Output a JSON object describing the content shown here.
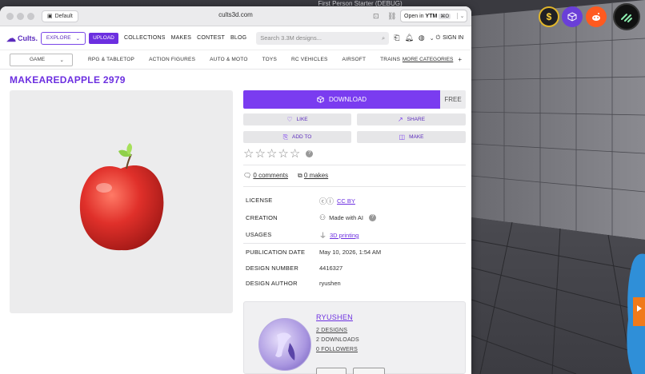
{
  "game": {
    "window_title": "First Person Starter (DEBUG)",
    "overlay_icons": [
      "dollar-icon",
      "cube-icon",
      "reddit-icon",
      "app-logo-icon"
    ]
  },
  "browser": {
    "profile_label": "Default",
    "url": "cults3d.com",
    "open_in_label": "Open in",
    "open_in_app": "YTM",
    "open_in_shortcut": "⌘O"
  },
  "site": {
    "brand": "Cults.",
    "explore_label": "EXPLORE",
    "upload_label": "UPLOAD",
    "nav": [
      "COLLECTIONS",
      "MAKES",
      "CONTEST",
      "BLOG"
    ],
    "search_placeholder": "Search 3.3M designs...",
    "signin_label": "SIGN IN",
    "category_select": "GAME",
    "categories": [
      "RPG & TABLETOP",
      "ACTION FIGURES",
      "AUTO & MOTO",
      "TOYS",
      "RC VEHICLES",
      "AIRSOFT",
      "TRAINS"
    ],
    "more_categories": "MORE CATEGORIES",
    "more_plus": "+"
  },
  "design": {
    "title": "MAKEAREDAPPLE 2979",
    "download_label": "DOWNLOAD",
    "price_label": "FREE",
    "like_label": "LIKE",
    "share_label": "SHARE",
    "add_to_label": "ADD TO",
    "make_label": "MAKE",
    "rating_help": "?",
    "comments": "0 comments",
    "makes": "0 makes",
    "info": {
      "license_label": "LICENSE",
      "license_value": "CC BY",
      "creation_label": "CREATION",
      "creation_value": "Made with AI",
      "usages_label": "USAGES",
      "usages_value": "3D printing",
      "pubdate_label": "PUBLICATION DATE",
      "pubdate_value": "May 10, 2026, 1:54 AM",
      "number_label": "DESIGN NUMBER",
      "number_value": "4416327",
      "author_label": "DESIGN AUTHOR",
      "author_value": "ryushen"
    }
  },
  "author": {
    "name": "RYUSHEN",
    "designs": "2 DESIGNS",
    "downloads": "2 DOWNLOADS",
    "followers": "0 FOLLOWERS"
  },
  "colors": {
    "accent": "#6c2fe0",
    "download_bg": "#7a3cf0"
  }
}
